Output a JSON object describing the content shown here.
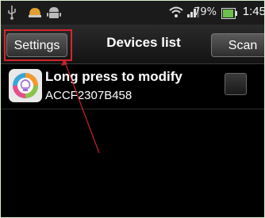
{
  "status_bar": {
    "battery_percent": "79%",
    "time": "1:45",
    "icons": [
      "usb-icon",
      "notification-icon",
      "android-icon",
      "wifi-icon",
      "signal-icon",
      "battery-icon"
    ]
  },
  "title_bar": {
    "settings_label": "Settings",
    "title": "Devices list",
    "scan_label": "Scan"
  },
  "devices": [
    {
      "name": "Long press to modify",
      "id": "ACCF2307B458",
      "checked": false
    }
  ],
  "colors": {
    "highlight": "#d8242c",
    "frame": "#d9edd0",
    "background": "#000000"
  }
}
